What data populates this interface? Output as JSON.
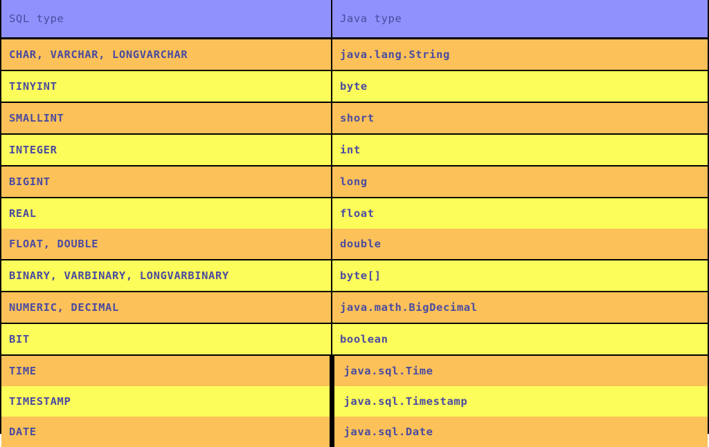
{
  "table": {
    "name": "sql-to-java-type-mapping",
    "columns": [
      {
        "key": "sql",
        "header": "SQL type"
      },
      {
        "key": "java",
        "header": "Java type"
      }
    ],
    "colors": {
      "header_background": "#9191fd",
      "row_background_a": "#fcc158",
      "row_background_b": "#fcfc5a",
      "text": "#4b4ba0",
      "border": "#000000",
      "page_background": "#ffffff"
    },
    "rows": [
      {
        "sql": "CHAR, VARCHAR, LONGVARCHAR",
        "java": "java.lang.String"
      },
      {
        "sql": "TINYINT",
        "java": "byte"
      },
      {
        "sql": "SMALLINT",
        "java": "short"
      },
      {
        "sql": "INTEGER",
        "java": "int"
      },
      {
        "sql": "BIGINT",
        "java": "long"
      },
      {
        "sql": "REAL",
        "java": "float"
      },
      {
        "sql": "FLOAT, DOUBLE",
        "java": "double"
      },
      {
        "sql": "BINARY, VARBINARY, LONGVARBINARY",
        "java": "byte[]"
      },
      {
        "sql": "NUMERIC, DECIMAL",
        "java": "java.math.BigDecimal"
      },
      {
        "sql": "BIT",
        "java": "boolean"
      },
      {
        "sql": "TIME",
        "java": "java.sql.Time"
      },
      {
        "sql": "TIMESTAMP",
        "java": "java.sql.Timestamp"
      },
      {
        "sql": "DATE",
        "java": "java.sql.Date"
      }
    ]
  }
}
